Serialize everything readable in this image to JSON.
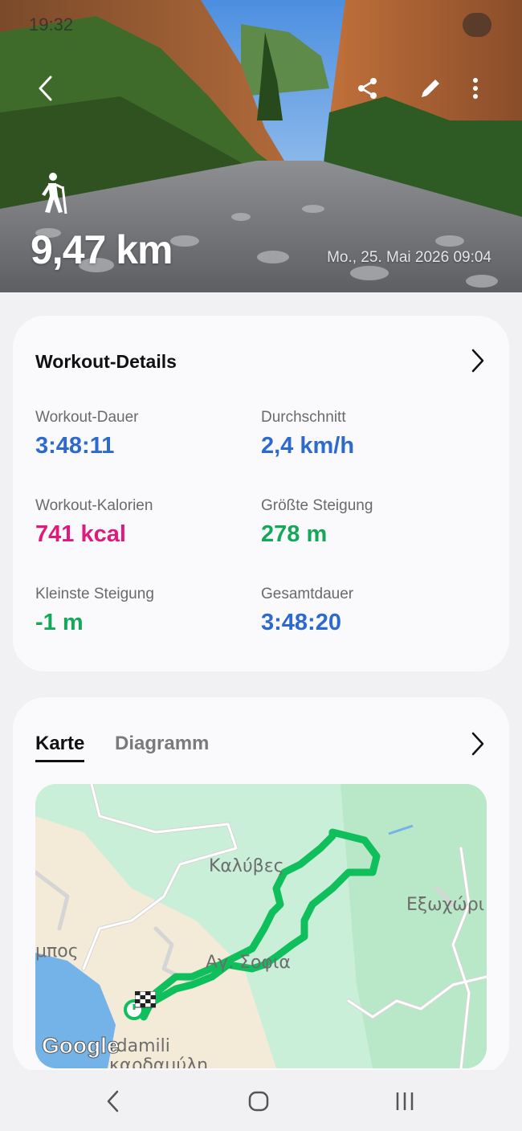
{
  "status": {
    "time": "19:32"
  },
  "hero": {
    "distance": "9,47 km",
    "date": "Mo., 25. Mai 2026 09:04"
  },
  "workout_details": {
    "title": "Workout-Details",
    "metrics": [
      {
        "label": "Workout-Dauer",
        "value": "3:48:11"
      },
      {
        "label": "Durchschnitt",
        "value": "2,4 km/h"
      },
      {
        "label": "Workout-Kalorien",
        "value": "741 kcal"
      },
      {
        "label": "Größte Steigung",
        "value": "278 m"
      },
      {
        "label": "Kleinste Steigung",
        "value": "-1 m"
      },
      {
        "label": "Gesamtdauer",
        "value": "3:48:20"
      }
    ]
  },
  "map_section": {
    "tabs": [
      {
        "label": "Karte",
        "active": true
      },
      {
        "label": "Diagramm",
        "active": false
      }
    ],
    "map_labels": {
      "kalyves": "Καλύβες",
      "exochori": "Εξωχώρι",
      "agia_sofia": "Αγ. Σοφια",
      "pos": "μπος",
      "kardamili": "rdamili",
      "kardamyli_gr": "καρδαμύλη"
    },
    "attribution": "Google"
  },
  "colors": {
    "blue": "#2c6ad1",
    "pink": "#e0197d",
    "green": "#16a85a",
    "route": "#0fbf5c"
  }
}
